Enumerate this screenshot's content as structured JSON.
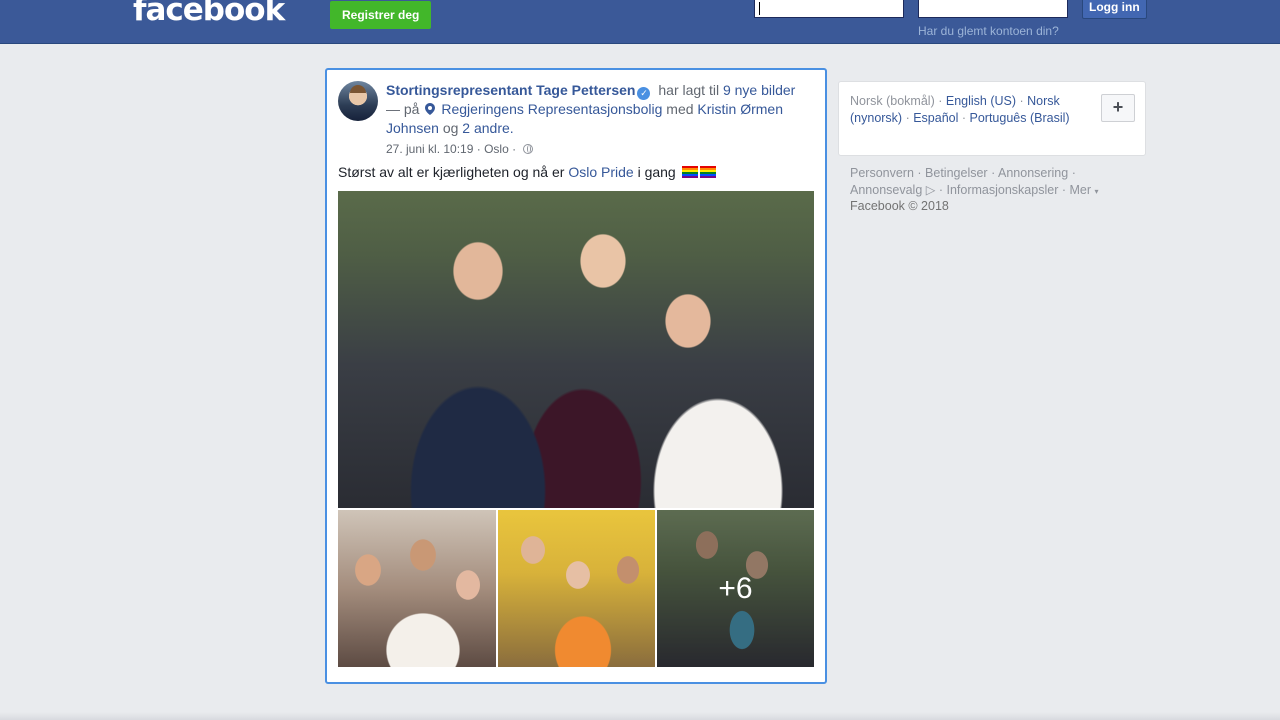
{
  "topbar": {
    "logo": "facebook",
    "register_label": "Registrer deg",
    "login_label": "Logg inn",
    "forgot_label": "Har du glemt kontoen din?"
  },
  "post": {
    "author": "Stortingsrepresentant Tage Pettersen",
    "action": "har lagt til",
    "photos_link": "9 nye bilder",
    "at_word": "— på",
    "place": "Regjeringens Representasjonsbolig",
    "with_word": "med",
    "tagged": "Kristin Ørmen Johnsen",
    "and_word": "og",
    "others": "2 andre.",
    "timestamp": "27. juni kl. 10:19",
    "location": "Oslo",
    "text_before": "Størst av alt er kjærligheten og nå er",
    "text_link": "Oslo Pride",
    "text_after": "i gang",
    "more_count": "+6"
  },
  "languages": {
    "current": "Norsk (bokmål)",
    "items": [
      "English (US)",
      "Norsk (nynorsk)",
      "Español",
      "Português (Brasil)"
    ]
  },
  "footer": {
    "links": [
      "Personvern",
      "Betingelser",
      "Annonsering",
      "Annonsevalg",
      "Informasjonskapsler",
      "Mer"
    ],
    "copyright": "Facebook © 2018"
  },
  "colors": {
    "topbar": "#3b5998",
    "link": "#365899",
    "register": "#42b72a",
    "highlight_border": "#4a90e2"
  }
}
